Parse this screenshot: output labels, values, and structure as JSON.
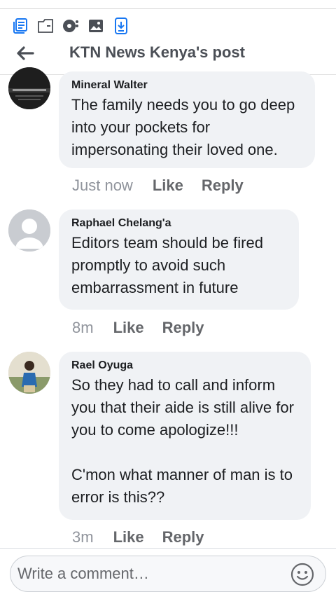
{
  "header": {
    "title": "KTN News Kenya's post"
  },
  "toolbar": {
    "icons": [
      "news-feed-icon",
      "folder-icon",
      "location-icon",
      "photo-icon",
      "download-icon"
    ],
    "accent": "#1877f2"
  },
  "comments": [
    {
      "author": "Mineral Walter",
      "text": "The family needs you to go deep into your pockets for impersonating their loved one.",
      "time": "Just now",
      "like": "Like",
      "reply": "Reply"
    },
    {
      "author": "Raphael Chelang'a",
      "text": "Editors team should be fired promptly to avoid such embarrassment in future",
      "time": "8m",
      "like": "Like",
      "reply": "Reply"
    },
    {
      "author": "Rael Oyuga",
      "text": "So they had to call and inform you that their aide is still alive for you to come apologize!!!\n\nC'mon what manner of man is to error is this??",
      "time": "3m",
      "like": "Like",
      "reply": "Reply"
    }
  ],
  "composer": {
    "placeholder": "Write a comment…"
  }
}
